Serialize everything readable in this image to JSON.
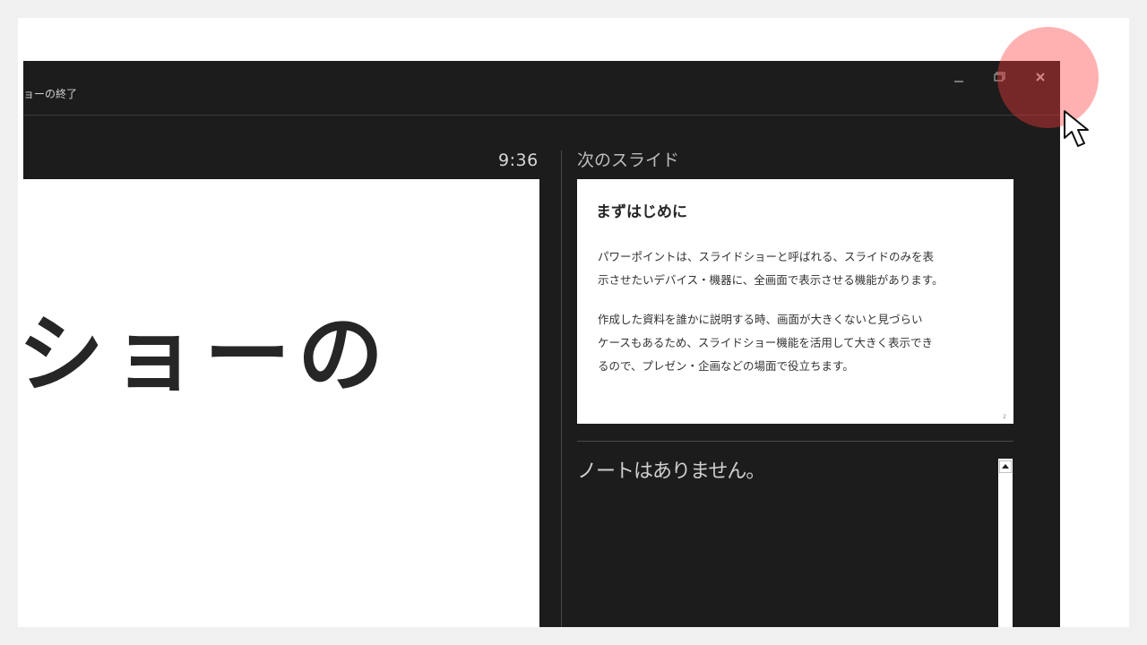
{
  "window": {
    "end_show_label": "ョーの終了",
    "timer": "9:36",
    "current_slide_text": "ショーの"
  },
  "next_slide": {
    "label": "次のスライド",
    "title": "まずはじめに",
    "paragraph1_line1": "パワーポイントは、スライドショーと呼ばれる、スライドのみを表",
    "paragraph1_line2": "示させたいデバイス・機器に、全画面で表示させる機能があります。",
    "paragraph2_line1": "作成した資料を誰かに説明する時、画面が大きくないと見づらい",
    "paragraph2_line2": "ケースもあるため、スライドショー機能を活用して大きく表示でき",
    "paragraph2_line3": "るので、プレゼン・企画などの場面で役立ちます。",
    "page_number": "2"
  },
  "notes": {
    "text": "ノートはありません。"
  },
  "icons": {
    "minimize": "minimize-icon",
    "restore": "restore-icon",
    "close": "close-icon",
    "cursor": "mouse-cursor-icon",
    "scroll_up": "scroll-up-arrow-icon"
  },
  "colors": {
    "window_bg": "#1c1c1c",
    "slide_bg": "#ffffff",
    "highlight": "#ff3c3c"
  }
}
